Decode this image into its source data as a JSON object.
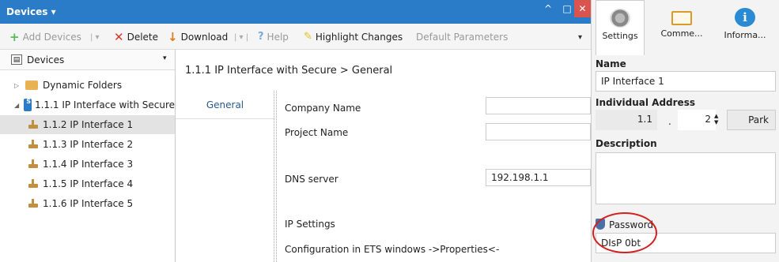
{
  "window": {
    "title": "Devices ▾",
    "btn_up": "^",
    "btn_restore": "□",
    "btn_close": "✕"
  },
  "toolbar": {
    "add_devices": "Add Devices",
    "delete": "Delete",
    "download": "Download",
    "help": "Help",
    "highlight_changes": "Highlight Changes",
    "default_parameters": "Default Parameters"
  },
  "sidebar": {
    "header": "Devices",
    "items": [
      {
        "label": "Dynamic Folders"
      },
      {
        "label": "1.1.1 IP Interface with Secure"
      },
      {
        "label": "1.1.2 IP Interface 1"
      },
      {
        "label": "1.1.3 IP Interface 2"
      },
      {
        "label": "1.1.4 IP Interface 3"
      },
      {
        "label": "1.1.5 IP Interface 4"
      },
      {
        "label": "1.1.6 IP Interface 5"
      }
    ]
  },
  "main": {
    "breadcrumb": "1.1.1 IP Interface with Secure > General",
    "tab_general": "General",
    "company_name_label": "Company Name",
    "company_name_value": "",
    "project_name_label": "Project Name",
    "project_name_value": "",
    "dns_label": "DNS server",
    "dns_value": "192.198.1.1",
    "ip_settings_label": "IP Settings",
    "config_note": "Configuration in ETS windows ->Properties<-"
  },
  "properties": {
    "tabs": [
      "Settings",
      "Comme...",
      "Informa..."
    ],
    "name_label": "Name",
    "name_value": "IP Interface 1",
    "addr_label": "Individual Address",
    "addr_prefix": "1.1",
    "addr_dot": ".",
    "addr_number": "2",
    "park_label": "Park",
    "description_label": "Description",
    "description_value": "",
    "password_label": "Password",
    "password_value": "DIsP 0bt"
  },
  "colors": {
    "titlebar": "#2a7bc8",
    "highlight_oval": "#d42020"
  }
}
